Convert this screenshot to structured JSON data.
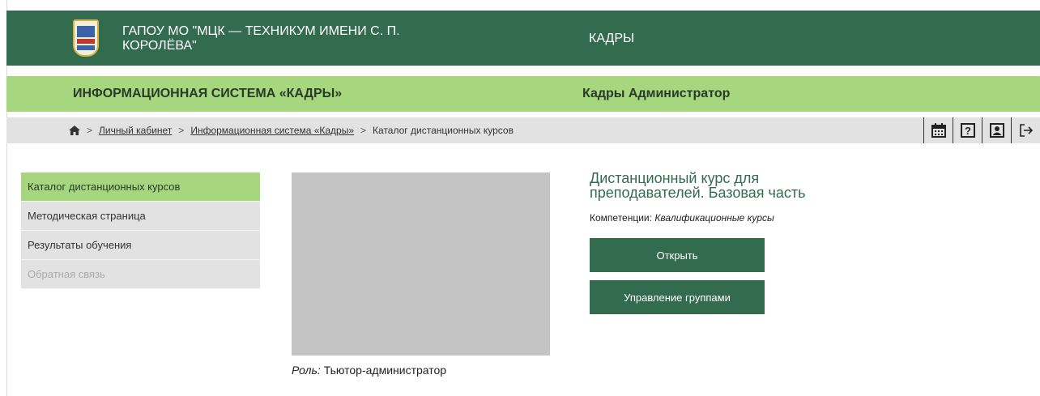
{
  "header": {
    "org_name": "ГАПОУ МО \"МЦК — ТЕХНИКУМ ИМЕНИ С. П. КОРОЛЁВА\"",
    "section": "КАДРЫ"
  },
  "subheader": {
    "system_title": "ИНФОРМАЦИОННАЯ СИСТЕМА «КАДРЫ»",
    "user_role": "Кадры Администратор"
  },
  "breadcrumb": {
    "items": [
      {
        "label": "Личный кабинет"
      },
      {
        "label": "Информационная система «Кадры»"
      },
      {
        "label": "Каталог дистанционных курсов"
      }
    ],
    "icons": [
      "home-icon",
      "calendar-icon",
      "help-icon",
      "profile-icon",
      "logout-icon"
    ]
  },
  "sidebar": {
    "items": [
      {
        "label": "Каталог дистанционных курсов",
        "state": "active"
      },
      {
        "label": "Методическая страница",
        "state": "normal"
      },
      {
        "label": "Результаты обучения",
        "state": "normal"
      },
      {
        "label": "Обратная связь",
        "state": "disabled"
      }
    ]
  },
  "course": {
    "title": "Дистанционный курс для преподавателей. Базовая часть",
    "competence_label": "Компетенции:",
    "competence_value": "Квалификационные курсы",
    "role_label": "Роль:",
    "role_value": "Тьютор-администратор",
    "open_button": "Открыть",
    "groups_button": "Управление группами"
  },
  "colors": {
    "dark_green": "#336b4f",
    "light_green": "#a6d67e",
    "gray_bar": "#e2e2e2",
    "image_placeholder": "#c4c4c4"
  }
}
